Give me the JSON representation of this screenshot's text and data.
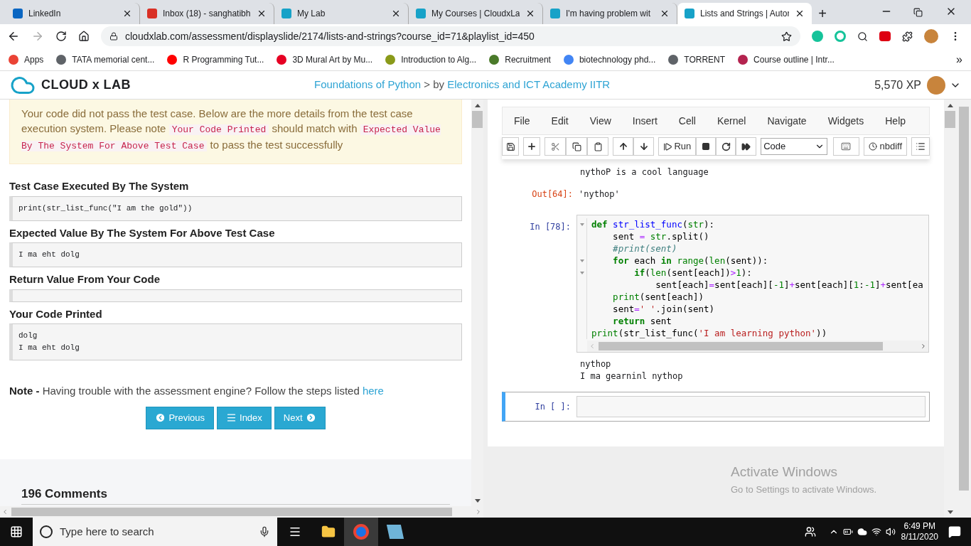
{
  "browser": {
    "tabs": [
      {
        "title": "LinkedIn",
        "color": "#0a66c2",
        "selected": false
      },
      {
        "title": "Inbox (18) - sanghatibh",
        "color": "#d93025",
        "selected": false
      },
      {
        "title": "My Lab",
        "color": "#17a2c8",
        "selected": false
      },
      {
        "title": "My Courses | CloudxLa",
        "color": "#17a2c8",
        "selected": false
      },
      {
        "title": "I'm having problem wit",
        "color": "#17a2c8",
        "selected": false
      },
      {
        "title": "Lists and Strings | Autor",
        "color": "#17a2c8",
        "selected": true
      }
    ],
    "new_tab": "+",
    "url": "cloudxlab.com/assessment/displayslide/2174/lists-and-strings?course_id=71&playlist_id=450",
    "bookmarks": [
      {
        "label": "Apps",
        "color": "#ea4335"
      },
      {
        "label": "TATA memorial cent...",
        "color": "#5f6368"
      },
      {
        "label": "R Programming Tut...",
        "color": "#ff0000"
      },
      {
        "label": "3D Mural Art by Mu...",
        "color": "#e60023"
      },
      {
        "label": "Introduction to Alg...",
        "color": "#8a9a1a"
      },
      {
        "label": "Recruitment",
        "color": "#4a7a2a"
      },
      {
        "label": "biotechnology phd...",
        "color": "#4285f4"
      },
      {
        "label": "TORRENT",
        "color": "#5f6368"
      },
      {
        "label": "Course outline | Intr...",
        "color": "#b4234f"
      }
    ],
    "more": "»"
  },
  "header": {
    "logo": "CLOUD x LAB",
    "course": "Foundations of Python",
    "separator": " > by ",
    "provider": "Electronics and ICT Academy IITR",
    "xp": "5,570 XP"
  },
  "alert": [
    {
      "kind": "text",
      "text": "Your code did not pass the test case. Below are the more details from the test case execution system. Please note "
    },
    {
      "kind": "code",
      "text": "Your Code Printed"
    },
    {
      "kind": "text",
      "text": " should match with "
    },
    {
      "kind": "code",
      "text": "Expected Value By The System For Above Test Case"
    },
    {
      "kind": "text",
      "text": " to pass the test successfully"
    }
  ],
  "sections": [
    {
      "heading": "Test Case Executed By The System",
      "lines": [
        "print(str_list_func(\"I am the gold\"))"
      ]
    },
    {
      "heading": "Expected Value By The System For Above Test Case",
      "lines": [
        "I ma eht dolg"
      ]
    },
    {
      "heading": "Return Value From Your Code"
    },
    {
      "heading": "Your Code Printed",
      "lines": [
        "dolg",
        "I ma eht dolg"
      ]
    }
  ],
  "note": {
    "label": "Note -",
    "text": " Having trouble with the assessment engine? Follow the steps listed ",
    "link": "here"
  },
  "nav_buttons": [
    {
      "label": "Previous",
      "kind": "prev"
    },
    {
      "label": "Index",
      "kind": "index"
    },
    {
      "label": "Next",
      "kind": "next"
    }
  ],
  "comments": "196 Comments",
  "notebook": {
    "menu": [
      "File",
      "Edit",
      "View",
      "Insert",
      "Cell",
      "Kernel",
      "Navigate",
      "Widgets",
      "Help"
    ],
    "run": "Run",
    "cell_type": "Code",
    "nbdiff": "nbdiff",
    "stream_top": "nythoP is a cool language",
    "out_prompt": "Out[64]:",
    "out_value": "'nythop'",
    "in_prompt": "In [78]:",
    "code": [
      {
        "foldable": true,
        "tokens": [
          {
            "kind": "kw",
            "text": "def "
          },
          {
            "kind": "fn",
            "text": "str_list_func"
          },
          {
            "kind": "plain",
            "text": "("
          },
          {
            "kind": "bi",
            "text": "str"
          },
          {
            "kind": "plain",
            "text": "):"
          }
        ]
      },
      {
        "foldable": false,
        "tokens": [
          {
            "kind": "plain",
            "text": "    sent "
          },
          {
            "kind": "op",
            "text": "="
          },
          {
            "kind": "bi",
            "text": " str"
          },
          {
            "kind": "plain",
            "text": ".split()"
          }
        ]
      },
      {
        "foldable": false,
        "tokens": [
          {
            "kind": "com",
            "text": "    #print(sent)"
          }
        ]
      },
      {
        "foldable": true,
        "tokens": [
          {
            "kind": "kw",
            "text": "    for"
          },
          {
            "kind": "plain",
            "text": " each "
          },
          {
            "kind": "kw",
            "text": "in"
          },
          {
            "kind": "bi",
            "text": " range"
          },
          {
            "kind": "plain",
            "text": "("
          },
          {
            "kind": "bi",
            "text": "len"
          },
          {
            "kind": "plain",
            "text": "(sent)):"
          }
        ]
      },
      {
        "foldable": true,
        "tokens": [
          {
            "kind": "kw",
            "text": "        if"
          },
          {
            "kind": "plain",
            "text": "("
          },
          {
            "kind": "bi",
            "text": "len"
          },
          {
            "kind": "plain",
            "text": "(sent[each])"
          },
          {
            "kind": "op",
            "text": ">"
          },
          {
            "kind": "num",
            "text": "1"
          },
          {
            "kind": "plain",
            "text": "):"
          }
        ]
      },
      {
        "foldable": false,
        "tokens": [
          {
            "kind": "plain",
            "text": "            sent[each]"
          },
          {
            "kind": "op",
            "text": "="
          },
          {
            "kind": "plain",
            "text": "sent[each]["
          },
          {
            "kind": "num",
            "text": "-1"
          },
          {
            "kind": "plain",
            "text": "]"
          },
          {
            "kind": "op",
            "text": "+"
          },
          {
            "kind": "plain",
            "text": "sent[each]["
          },
          {
            "kind": "num",
            "text": "1"
          },
          {
            "kind": "plain",
            "text": ":"
          },
          {
            "kind": "num",
            "text": "-1"
          },
          {
            "kind": "plain",
            "text": "]"
          },
          {
            "kind": "op",
            "text": "+"
          },
          {
            "kind": "plain",
            "text": "sent[ea"
          }
        ]
      },
      {
        "foldable": false,
        "tokens": [
          {
            "kind": "bi",
            "text": "    print"
          },
          {
            "kind": "plain",
            "text": "(sent[each])"
          }
        ]
      },
      {
        "foldable": false,
        "tokens": [
          {
            "kind": "plain",
            "text": "    sent"
          },
          {
            "kind": "op",
            "text": "="
          },
          {
            "kind": "str",
            "text": "' '"
          },
          {
            "kind": "plain",
            "text": ".join(sent)"
          }
        ]
      },
      {
        "foldable": false,
        "tokens": [
          {
            "kind": "kw",
            "text": "    return"
          },
          {
            "kind": "plain",
            "text": " sent"
          }
        ]
      },
      {
        "foldable": false,
        "tokens": [
          {
            "kind": "bi",
            "text": "print"
          },
          {
            "kind": "plain",
            "text": "(str_list_func("
          },
          {
            "kind": "str",
            "text": "'I am learning python'"
          },
          {
            "kind": "plain",
            "text": "))"
          }
        ]
      }
    ],
    "output": [
      "nythop",
      "I ma gearninl nythop"
    ],
    "empty_prompt": "In [ ]:"
  },
  "activation": {
    "title": "Activate Windows",
    "text": "Go to Settings to activate Windows."
  },
  "taskbar": {
    "search": "Type here to search",
    "time": "6:49 PM",
    "date": "8/11/2020"
  }
}
